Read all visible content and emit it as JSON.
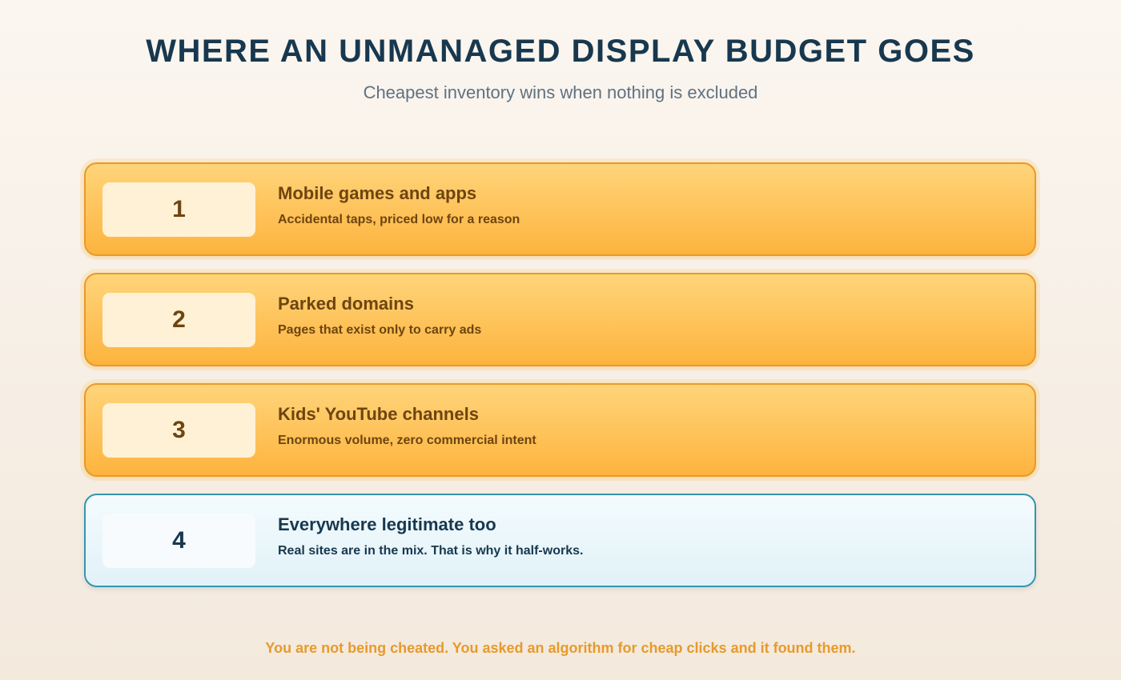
{
  "header": {
    "title": "WHERE AN UNMANAGED DISPLAY BUDGET GOES",
    "subtitle": "Cheapest inventory wins when nothing is excluded"
  },
  "rows": [
    {
      "number": "1",
      "title": "Mobile games and apps",
      "description": "Accidental taps, priced low for a reason",
      "style": "warning"
    },
    {
      "number": "2",
      "title": "Parked domains",
      "description": "Pages that exist only to carry ads",
      "style": "warning"
    },
    {
      "number": "3",
      "title": "Kids' YouTube channels",
      "description": "Enormous volume, zero commercial intent",
      "style": "warning"
    },
    {
      "number": "4",
      "title": "Everywhere legitimate too",
      "description": "Real sites are in the mix. That is why it half-works.",
      "style": "neutral"
    }
  ],
  "footer": {
    "text": "You are not being cheated. You asked an algorithm for cheap clicks and it found them."
  },
  "colors": {
    "title": "#17384f",
    "warning_fill": "#fdb43e",
    "warning_border": "#e79a2b",
    "neutral_fill": "#e1f2f8",
    "neutral_border": "#3595ad",
    "footer": "#e79a2b"
  }
}
